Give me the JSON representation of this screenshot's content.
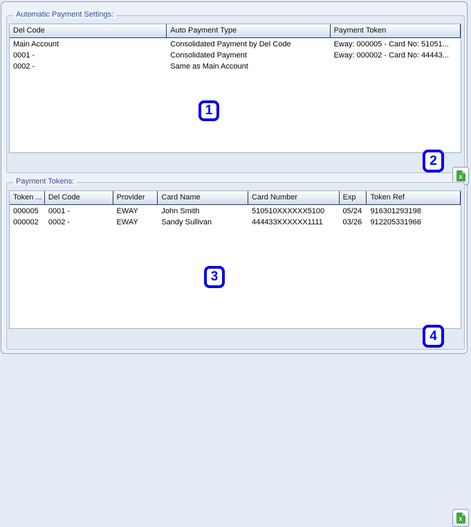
{
  "panel": {
    "groups": [
      {
        "title": "Automatic Payment Settings:",
        "table": {
          "columns": [
            "Del Code",
            "Auto Payment Type",
            "Payment Token"
          ],
          "rows": [
            [
              "Main Account",
              "Consolidated Payment by Del Code",
              "Eway: 000005 - Card No: 51051..."
            ],
            [
              "0001 -",
              "Consolidated Payment",
              "Eway: 000002 - Card No: 44443..."
            ],
            [
              "0002 -",
              "Same as Main Account",
              ""
            ]
          ]
        }
      },
      {
        "title": "Payment Tokens:",
        "table": {
          "columns": [
            "Token ...",
            "Del Code",
            "Provider",
            "Card Name",
            "Card Number",
            "Exp",
            "Token Ref"
          ],
          "rows": [
            [
              "000005",
              "0001 -",
              "EWAY",
              "John Smith",
              "510510XXXXXX5100",
              "05/24",
              "916301293198"
            ],
            [
              "000002",
              "0002 -",
              "EWAY",
              "Sandy Sullivan",
              "444433XXXXXX1111",
              "03/26",
              "912205331966"
            ]
          ]
        }
      }
    ],
    "export_buttons": [
      {
        "icon": "excel-export-icon",
        "glyph": "x"
      },
      {
        "icon": "excel-export-icon",
        "glyph": "x"
      }
    ],
    "callouts": [
      "1",
      "2",
      "3",
      "4"
    ],
    "colors": {
      "callout_blue": "#0000ee",
      "group_title_blue": "#3350a2",
      "excel_green": "#44a53f",
      "header_border_navy": "#1c3a64"
    }
  }
}
